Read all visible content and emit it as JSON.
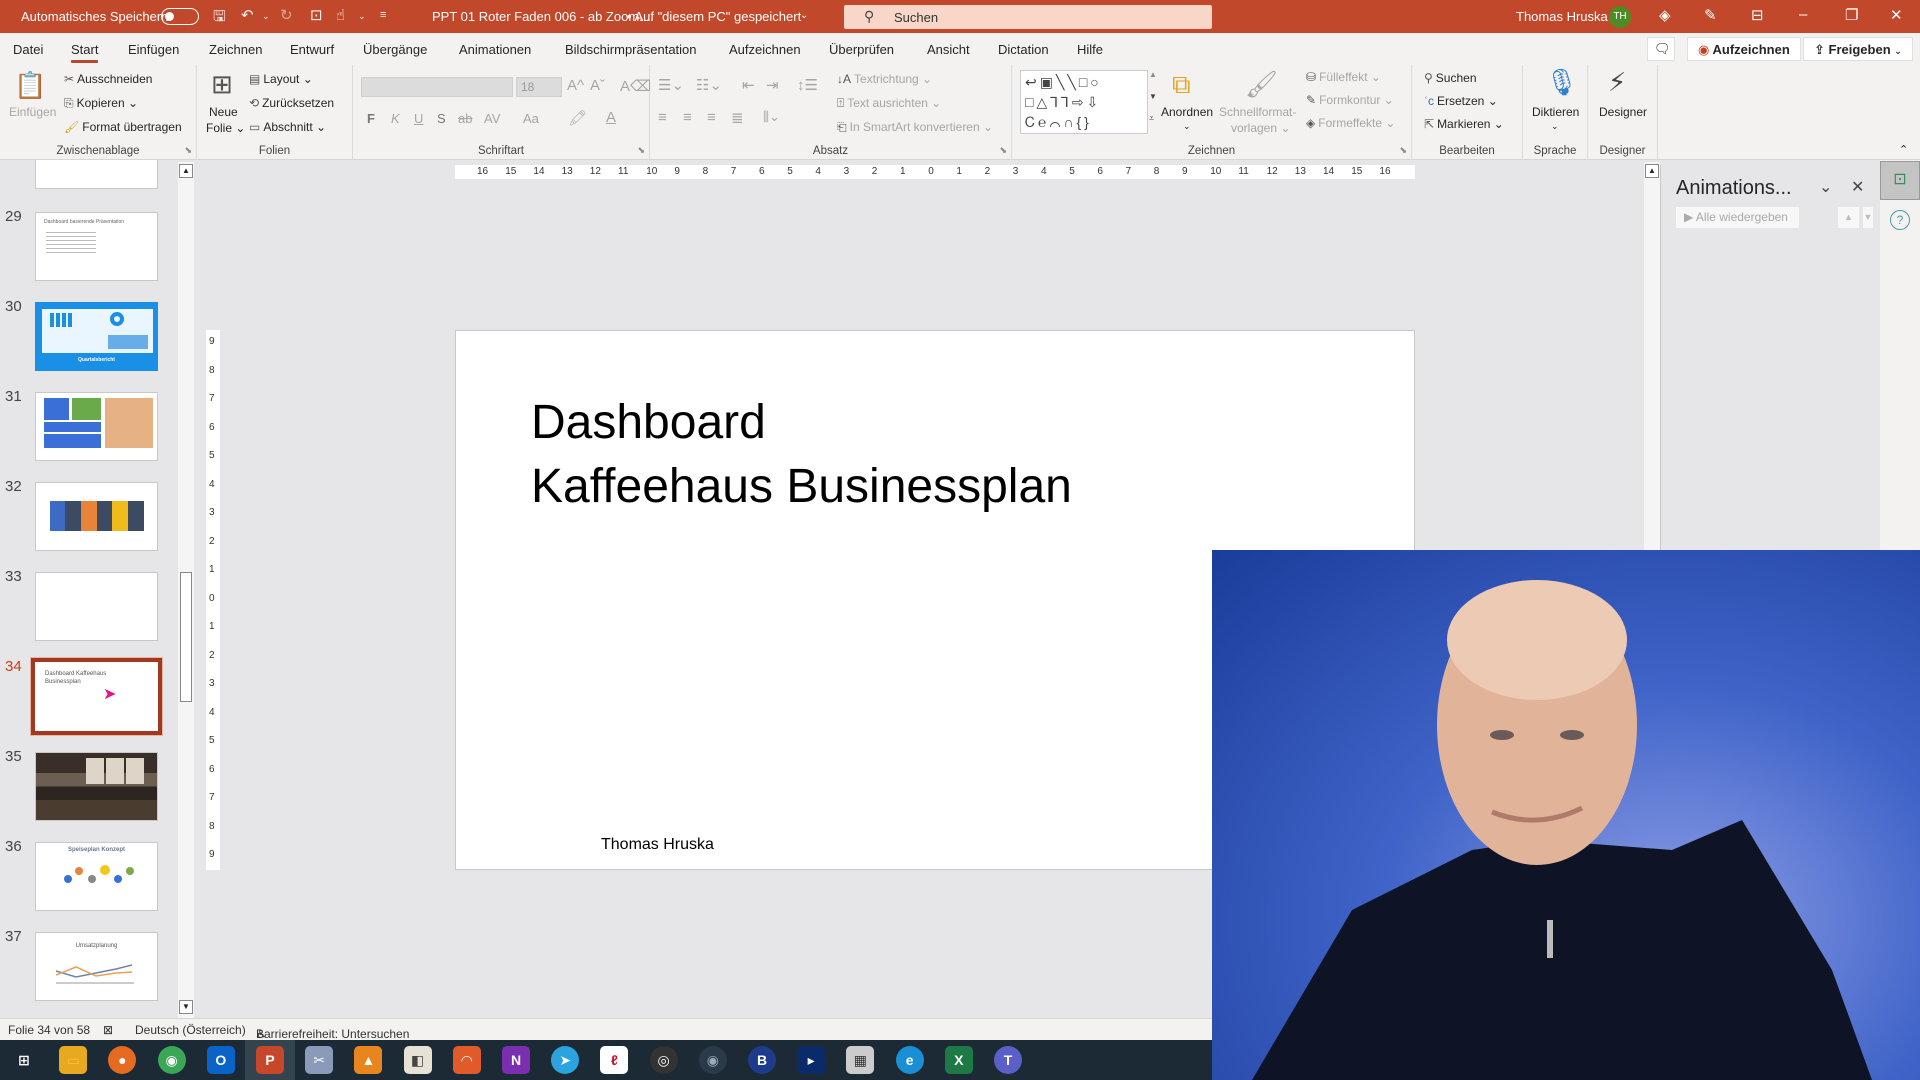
{
  "titlebar": {
    "autosave_label": "Automatisches Speichern",
    "doc_title": "PPT 01 Roter Faden 006 - ab Zoom....",
    "save_status": "• Auf \"diesem PC\" gespeichert",
    "search_placeholder": "Suchen",
    "user_name": "Thomas Hruska",
    "user_initials": "TH"
  },
  "tabs": [
    "Datei",
    "Start",
    "Einfügen",
    "Zeichnen",
    "Entwurf",
    "Übergänge",
    "Animationen",
    "Bildschirmpräsentation",
    "Aufzeichnen",
    "Überprüfen",
    "Ansicht",
    "Dictation",
    "Hilfe"
  ],
  "active_tab": "Start",
  "top_buttons": {
    "record": "Aufzeichnen",
    "share": "Freigeben"
  },
  "ribbon": {
    "zwischenablage": {
      "label": "Zwischenablage",
      "paste": "Einfügen",
      "cut": "Ausschneiden",
      "copy": "Kopieren",
      "format_painter": "Format übertragen"
    },
    "folien": {
      "label": "Folien",
      "new_slide_1": "Neue",
      "new_slide_2": "Folie",
      "layout": "Layout",
      "reset": "Zurücksetzen",
      "section": "Abschnitt"
    },
    "schriftart": {
      "label": "Schriftart",
      "font_size": "18",
      "bold": "F",
      "italic": "K",
      "underline": "U",
      "shadow": "S",
      "strike": "ab",
      "spacing": "AV",
      "case": "Aa"
    },
    "absatz": {
      "label": "Absatz",
      "text_direction": "Textrichtung",
      "align_text": "Text ausrichten",
      "smartart": "In SmartArt konvertieren"
    },
    "zeichnen": {
      "label": "Zeichnen",
      "arrange": "Anordnen",
      "quick_styles_1": "Schnellformat-",
      "quick_styles_2": "vorlagen",
      "fill": "Fülleffekt",
      "outline": "Formkontur",
      "effects": "Formeffekte"
    },
    "bearbeiten": {
      "label": "Bearbeiten",
      "find": "Suchen",
      "replace": "Ersetzen",
      "select": "Markieren"
    },
    "sprache": {
      "label": "Sprache",
      "dictate": "Diktieren"
    },
    "designer": {
      "label": "Designer",
      "designer": "Designer"
    }
  },
  "thumbnails": [
    {
      "num": "29",
      "caption": "Dashboard basierende Präsentation"
    },
    {
      "num": "30",
      "caption": "Quartalsbericht"
    },
    {
      "num": "31",
      "caption": ""
    },
    {
      "num": "32",
      "caption": ""
    },
    {
      "num": "33",
      "caption": ""
    },
    {
      "num": "34",
      "caption": "Dashboard Kaffeehaus Businessplan",
      "selected": true
    },
    {
      "num": "35",
      "caption": ""
    },
    {
      "num": "36",
      "caption": "Speiseplan Konzept"
    },
    {
      "num": "37",
      "caption": "Umsatzplanung"
    }
  ],
  "ruler": {
    "horizontal": [
      "16",
      "15",
      "14",
      "13",
      "12",
      "11",
      "10",
      "9",
      "8",
      "7",
      "6",
      "5",
      "4",
      "3",
      "2",
      "1",
      "0",
      "1",
      "2",
      "3",
      "4",
      "5",
      "6",
      "7",
      "8",
      "9",
      "10",
      "11",
      "12",
      "13",
      "14",
      "15",
      "16"
    ],
    "vertical": [
      "9",
      "8",
      "7",
      "6",
      "5",
      "4",
      "3",
      "2",
      "1",
      "0",
      "1",
      "2",
      "3",
      "4",
      "5",
      "6",
      "7",
      "8",
      "9"
    ]
  },
  "slide": {
    "title_line1": "Dashboard",
    "title_line2": "Kaffeehaus Businessplan",
    "author": "Thomas Hruska"
  },
  "anim_pane": {
    "title": "Animations...",
    "play_all": "Alle wiedergeben"
  },
  "status": {
    "slide_info": "Folie 34 von 58",
    "language": "Deutsch (Österreich)",
    "accessibility": "Barrierefreiheit: Untersuchen"
  },
  "taskbar": [
    "windows-start",
    "file-explorer",
    "firefox",
    "chrome",
    "outlook",
    "powerpoint",
    "snipping-tool",
    "vlc",
    "paint",
    "speech-app",
    "onenote",
    "telegram",
    "adobe-reader",
    "obs",
    "screen-recorder",
    "blue-yeti",
    "video-editor",
    "network-monitor",
    "edge",
    "excel",
    "teams"
  ],
  "colors": {
    "accent": "#c2482b",
    "selected_thumb": "#a0391f",
    "tab_underline": "#b7472a"
  }
}
